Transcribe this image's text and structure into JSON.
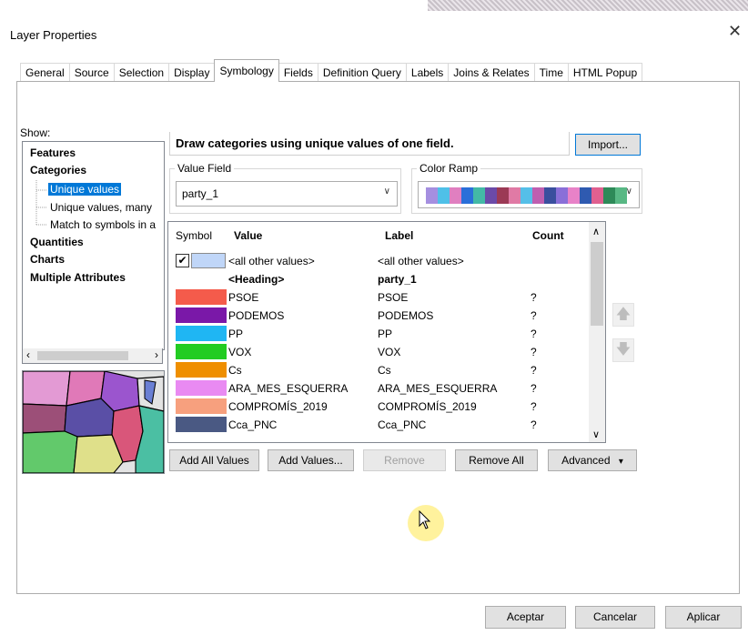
{
  "window": {
    "title": "Layer Properties",
    "close_glyph": "✕"
  },
  "tabs": [
    {
      "label": "General"
    },
    {
      "label": "Source"
    },
    {
      "label": "Selection"
    },
    {
      "label": "Display"
    },
    {
      "label": "Symbology",
      "active": true
    },
    {
      "label": "Fields"
    },
    {
      "label": "Definition Query"
    },
    {
      "label": "Labels"
    },
    {
      "label": "Joins & Relates"
    },
    {
      "label": "Time"
    },
    {
      "label": "HTML Popup"
    }
  ],
  "show": {
    "label": "Show:",
    "items": [
      {
        "label": "Features"
      },
      {
        "label": "Categories"
      },
      {
        "label": "Unique values"
      },
      {
        "label": "Unique values, many"
      },
      {
        "label": "Match to symbols in a"
      },
      {
        "label": "Quantities"
      },
      {
        "label": "Charts"
      },
      {
        "label": "Multiple Attributes"
      }
    ]
  },
  "description": "Draw categories using unique values of one field.",
  "import_button": "Import...",
  "value_field": {
    "caption": "Value Field",
    "value": "party_1"
  },
  "color_ramp": {
    "caption": "Color Ramp",
    "colors": [
      "#a58fe0",
      "#4fc0e8",
      "#e07fc0",
      "#2a6fd9",
      "#43b9a6",
      "#6b4aa8",
      "#9b3a55",
      "#e07aa5",
      "#55bfe8",
      "#bf5fb0",
      "#3a4f9e",
      "#8a6fd8",
      "#e882c8",
      "#2f5ab0",
      "#e06090",
      "#2e8a58",
      "#58b884"
    ]
  },
  "table": {
    "headers": {
      "symbol": "Symbol",
      "value": "Value",
      "label": "Label",
      "count": "Count"
    },
    "rows": [
      {
        "color": "#c0d6f8",
        "value": "<all other values>",
        "label": "<all other values>",
        "count": "",
        "checked": true
      },
      {
        "color": "",
        "value": "<Heading>",
        "label": "party_1",
        "count": "",
        "heading": true
      },
      {
        "color": "#f45b4b",
        "value": "PSOE",
        "label": "PSOE",
        "count": "?"
      },
      {
        "color": "#7a18a8",
        "value": "PODEMOS",
        "label": "PODEMOS",
        "count": "?"
      },
      {
        "color": "#1fb6f3",
        "value": "PP",
        "label": "PP",
        "count": "?"
      },
      {
        "color": "#22cc22",
        "value": "VOX",
        "label": "VOX",
        "count": "?"
      },
      {
        "color": "#ef8f00",
        "value": "Cs",
        "label": "Cs",
        "count": "?"
      },
      {
        "color": "#e98af2",
        "value": "ARA_MES_ESQUERRA",
        "label": "ARA_MES_ESQUERRA",
        "count": "?"
      },
      {
        "color": "#f7a07e",
        "value": "COMPROMÍS_2019",
        "label": "COMPROMÍS_2019",
        "count": "?"
      },
      {
        "color": "#4a5983",
        "value": "Cca_PNC",
        "label": "Cca_PNC",
        "count": "?"
      }
    ]
  },
  "buttons": {
    "add_all": "Add All Values",
    "add_values": "Add Values...",
    "remove": "Remove",
    "remove_all": "Remove All",
    "advanced": "Advanced",
    "advanced_arrow": "▾"
  },
  "footer": {
    "ok": "Aceptar",
    "cancel": "Cancelar",
    "apply": "Aplicar"
  }
}
